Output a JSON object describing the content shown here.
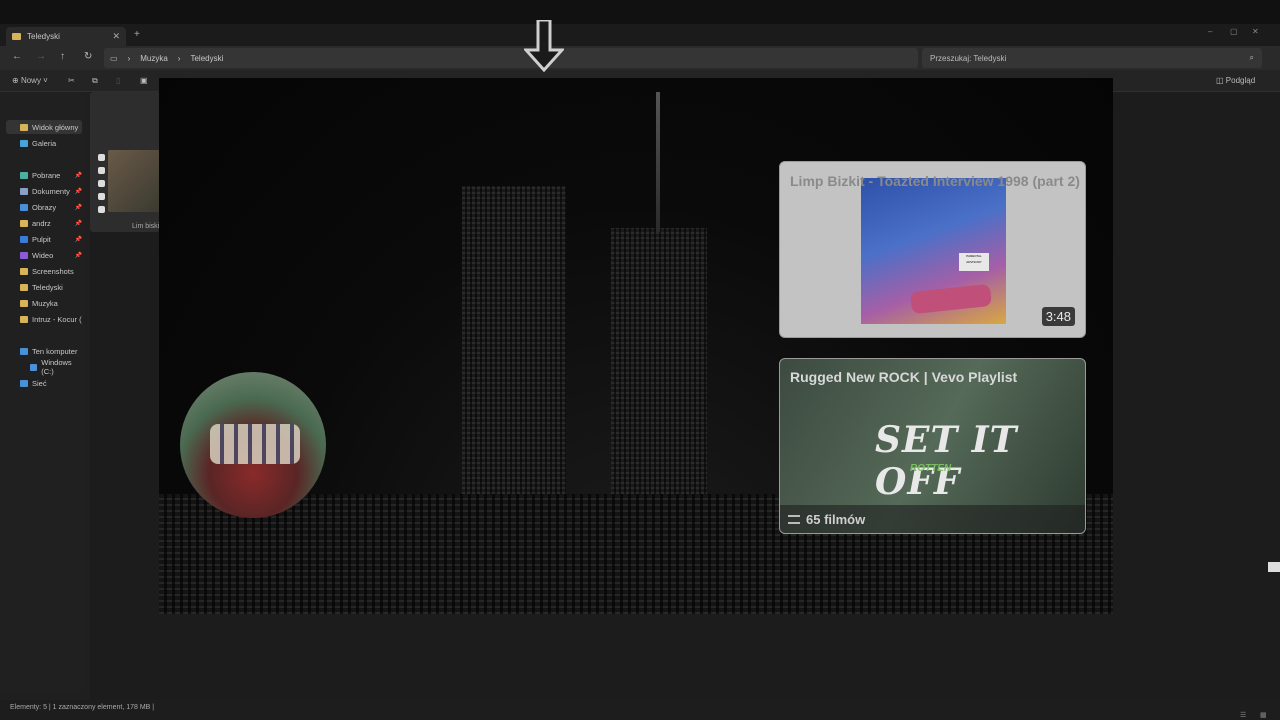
{
  "window": {
    "tab_title": "Teledyski",
    "new_tab": "+"
  },
  "address": {
    "crumbs": [
      "Muzyka",
      "Teledyski"
    ],
    "search_placeholder": "Przeszukaj: Teledyski"
  },
  "toolbar": {
    "new_label": "Nowy",
    "preview_label": "Podgląd"
  },
  "sidebar": {
    "items": [
      {
        "label": "Widok główny",
        "color": "#d8b35a"
      },
      {
        "label": "Galeria",
        "color": "#4aa3d8"
      },
      {
        "label": "Pobrane",
        "color": "#4ab0a0",
        "pinned": true
      },
      {
        "label": "Dokumenty",
        "color": "#8aa0c8",
        "pinned": true
      },
      {
        "label": "Obrazy",
        "color": "#4a90d8",
        "pinned": true
      },
      {
        "label": "andrz",
        "color": "#d8b35a",
        "pinned": true
      },
      {
        "label": "Pulpit",
        "color": "#3a7ad8",
        "pinned": true
      },
      {
        "label": "Wideo",
        "color": "#8a5ad8",
        "pinned": true
      },
      {
        "label": "Screenshots",
        "color": "#d8b35a"
      },
      {
        "label": "Teledyski",
        "color": "#d8b35a"
      },
      {
        "label": "Muzyka",
        "color": "#d8b35a"
      },
      {
        "label": "Intruz - Kocur (",
        "color": "#d8b35a"
      },
      {
        "label": "Ten komputer",
        "color": "#4a90d8"
      },
      {
        "label": "Windows (C:)",
        "color": "#4a90d8"
      },
      {
        "label": "Sieć",
        "color": "#4a90d8"
      }
    ]
  },
  "files": {
    "visible_name": "Lim biski"
  },
  "status": {
    "text": "Elementy: 5  |  1 zaznaczony element, 178 MB  |"
  },
  "video_overlay": {
    "card1": {
      "title": "Limp Bizkit - Toazted Interview 1998 (part 2)",
      "duration": "3:48"
    },
    "card2": {
      "title": "Rugged New ROCK | Vevo Playlist",
      "band": "SET IT OFF",
      "subtitle": "ROTTEN",
      "count": "65 filmów"
    }
  }
}
